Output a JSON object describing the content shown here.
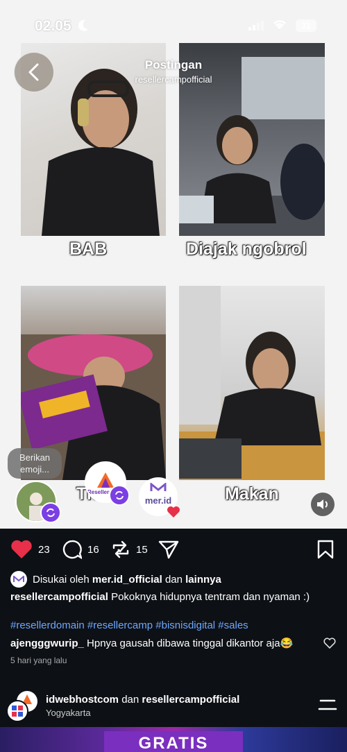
{
  "status": {
    "time": "02.05",
    "battery": "31"
  },
  "header": {
    "title": "Postingan",
    "username": "resellercampofficial"
  },
  "panels": {
    "caption1": "BAB",
    "caption2": "Diajak ngobrol",
    "caption3": "Tidur",
    "caption4": "Makan"
  },
  "overlay": {
    "emoji_prompt": "Berikan emoji...",
    "brand_label": "Resellercamp",
    "merid_label": "mer.id"
  },
  "actions": {
    "likes": "23",
    "comments": "16",
    "reposts": "15"
  },
  "post": {
    "liked_by_prefix": "Disukai oleh",
    "liked_by_user": "mer.id_official",
    "liked_by_and": "dan",
    "liked_by_others": "lainnya",
    "author": "resellercampofficial",
    "caption": "Pokoknya hidupnya tentram dan nyaman :)",
    "hashtags": "#resellerdomain #resellercamp #bisnisdigital #sales",
    "comment_user": "ajengggwurip_",
    "comment_text": "Hpnya gausah dibawa tinggal dikantor aja😂",
    "time_ago": "5 hari yang lalu"
  },
  "next_post": {
    "user1": "idwebhostcom",
    "and": "dan",
    "user2": "resellercampofficial",
    "location": "Yogyakarta"
  },
  "banner": {
    "text": "GRATIS"
  },
  "colors": {
    "like_red": "#e8304a",
    "hashtag_blue": "#6ea8ff",
    "repost_purple": "#7b3fe4",
    "background": "#0d1015"
  }
}
